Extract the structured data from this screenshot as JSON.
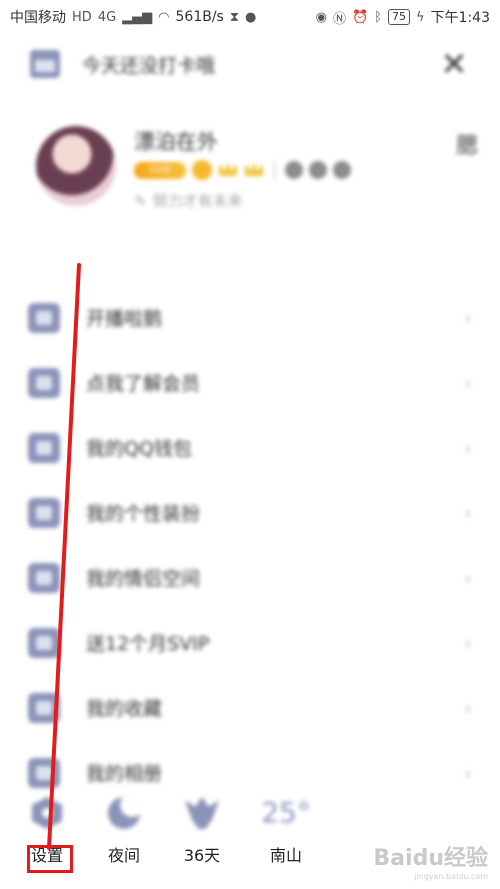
{
  "status_bar": {
    "carrier": "中国移动",
    "hd": "HD",
    "network": "4G",
    "speed": "561B/s",
    "battery": "75",
    "time": "下午1:43"
  },
  "header": {
    "checkin_text": "今天还没打卡哦"
  },
  "profile": {
    "nickname": "漂泊在外",
    "vip_badge": "SVIP",
    "signature": "努力才有未来",
    "right_icon_text": "腮"
  },
  "menu": {
    "items": [
      {
        "label": "开播啦鹅"
      },
      {
        "label": "点我了解会员"
      },
      {
        "label": "我的QQ钱包"
      },
      {
        "label": "我的个性装扮"
      },
      {
        "label": "我的情侣空间"
      },
      {
        "label": "送12个月SVIP"
      },
      {
        "label": "我的收藏"
      },
      {
        "label": "我的相册"
      }
    ]
  },
  "bottom": {
    "settings_label": "设置",
    "night_label": "夜间",
    "days_label": "36天",
    "temperature": "25°",
    "city_label": "南山"
  },
  "watermark": {
    "brand": "Baidu经验",
    "url": "jingyan.baidu.com"
  },
  "colors": {
    "accent": "#8b93b8",
    "annotation_red": "#e31b1b"
  }
}
